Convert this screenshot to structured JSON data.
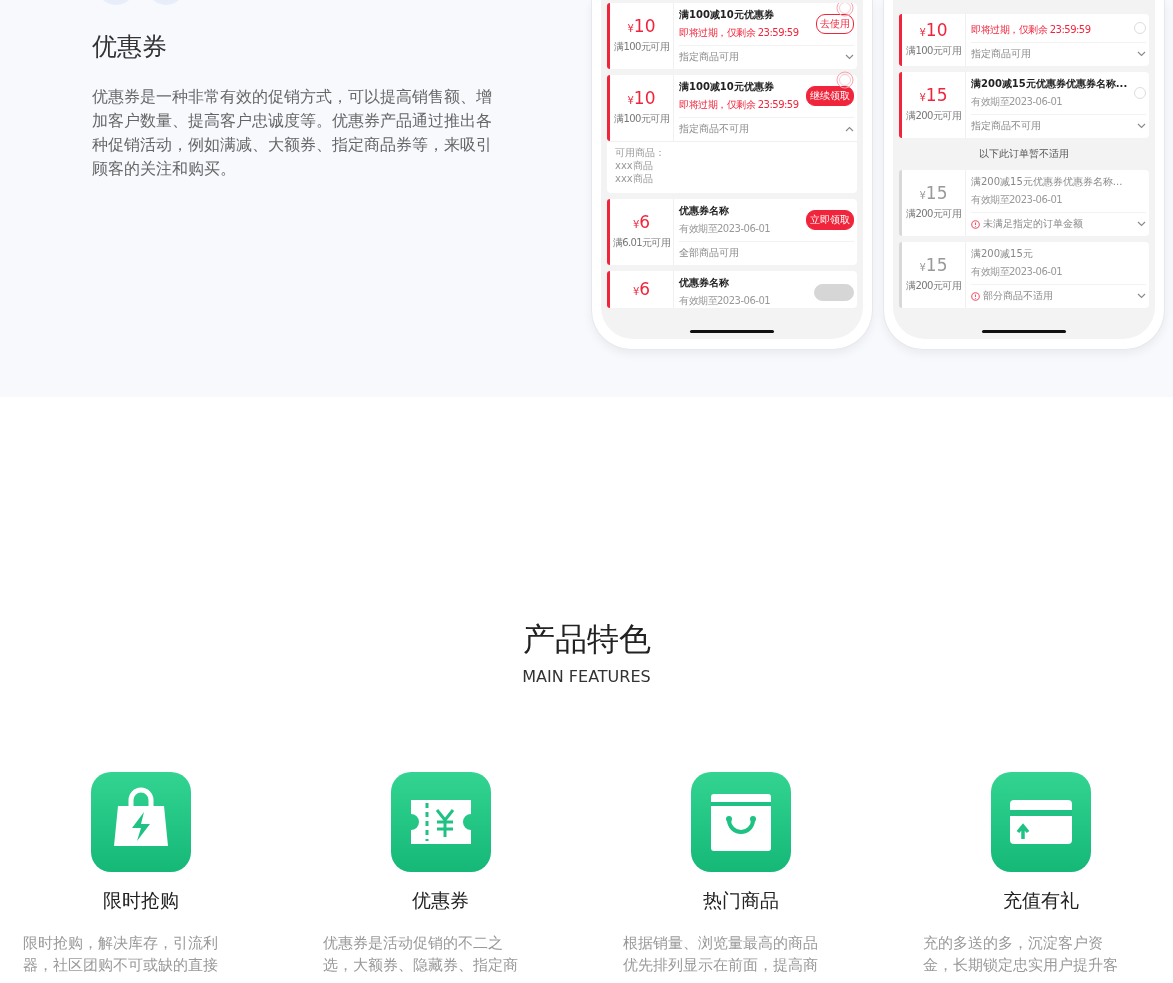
{
  "intro": {
    "title": "优惠券",
    "description": "优惠券是一种非常有效的促销方式，可以提高销售额、增加客户数量、提高客户忠诚度等。优惠券产品通过推出各种促销活动，例如满减、大额券、指定商品券等，来吸引顾客的关注和购买。"
  },
  "phones": [
    {
      "items": [
        {
          "kind": "coupon",
          "available": true,
          "currency": "¥",
          "amount": "10",
          "condition": "满100元可用",
          "title": "满100减10元优惠券",
          "subtitle": "即将过期，仅剩余 23:59:59",
          "urgent": true,
          "stamped": true,
          "action": {
            "kind": "outline",
            "label": "去使用"
          },
          "scope": "指定商品可用",
          "expanded": false
        },
        {
          "kind": "coupon",
          "available": true,
          "currency": "¥",
          "amount": "10",
          "condition": "满100元可用",
          "title": "满100减10元优惠券",
          "subtitle": "即将过期，仅剩余 23:59:59",
          "urgent": true,
          "stamped": true,
          "action": {
            "kind": "filled",
            "label": "继续领取"
          },
          "scope": "指定商品不可用",
          "expanded": true,
          "details": [
            "可用商品：",
            "xxx商品",
            "xxx商品"
          ]
        },
        {
          "kind": "coupon",
          "available": true,
          "currency": "¥",
          "amount": "6",
          "condition": "满6.01元可用",
          "title": "优惠券名称",
          "subtitle": "有效期至2023-06-01",
          "urgent": false,
          "stamped": false,
          "action": {
            "kind": "filled",
            "label": "立即领取"
          },
          "scope": "全部商品可用"
        },
        {
          "kind": "coupon",
          "available": true,
          "currency": "¥",
          "amount": "6",
          "title": "优惠券名称",
          "subtitle": "有效期至2023-06-01",
          "urgent": false,
          "stamped": false,
          "action": {
            "kind": "disabled"
          }
        }
      ]
    },
    {
      "items": [
        {
          "kind": "coupon",
          "available": true,
          "currency": "¥",
          "amount": "10",
          "condition": "满100元可用",
          "subtitle": "即将过期，仅剩余 23:59:59",
          "urgent": true,
          "stamped": false,
          "action": {
            "kind": "radio",
            "selected": false
          },
          "scope": "指定商品可用",
          "expanded": false
        },
        {
          "kind": "coupon",
          "available": true,
          "currency": "¥",
          "amount": "15",
          "condition": "满200元可用",
          "title": "满200减15元优惠券优惠券名称...",
          "subtitle": "有效期至2023-06-01",
          "urgent": false,
          "stamped": false,
          "action": {
            "kind": "radio",
            "selected": false
          },
          "scope": "指定商品不可用",
          "expanded": false
        },
        {
          "kind": "label",
          "text": "以下此订单暂不适用"
        },
        {
          "kind": "coupon",
          "available": false,
          "currency": "¥",
          "amount": "15",
          "condition": "满200元可用",
          "title": "满200减15元优惠券优惠券名称...",
          "subtitle": "有效期至2023-06-01",
          "urgent": false,
          "stamped": false,
          "warning": true,
          "scope": "未满足指定的订单金额",
          "expanded": false
        },
        {
          "kind": "coupon",
          "available": false,
          "currency": "¥",
          "amount": "15",
          "condition": "满200元可用",
          "title": "满200减15元",
          "subtitle": "有效期至2023-06-01",
          "urgent": false,
          "stamped": false,
          "warning": true,
          "scope": "部分商品不适用",
          "expanded": false
        }
      ]
    }
  ],
  "features": {
    "title": "产品特色",
    "subtitle": "MAIN FEATURES",
    "items": [
      {
        "kind": "bag",
        "title": "限时抢购",
        "description": "限时抢购，解决库存，引流利器，社区团购不可或缺的直接"
      },
      {
        "kind": "ticket",
        "title": "优惠券",
        "description": "优惠券是活动促销的不二之选，大额券、隐藏券、指定商"
      },
      {
        "kind": "basket",
        "title": "热门商品",
        "description": "根据销量、浏览量最高的商品优先排列显示在前面，提高商"
      },
      {
        "kind": "card",
        "title": "充值有礼",
        "description": "充的多送的多，沉淀客户资金，长期锁定忠实用户提升客"
      }
    ]
  }
}
